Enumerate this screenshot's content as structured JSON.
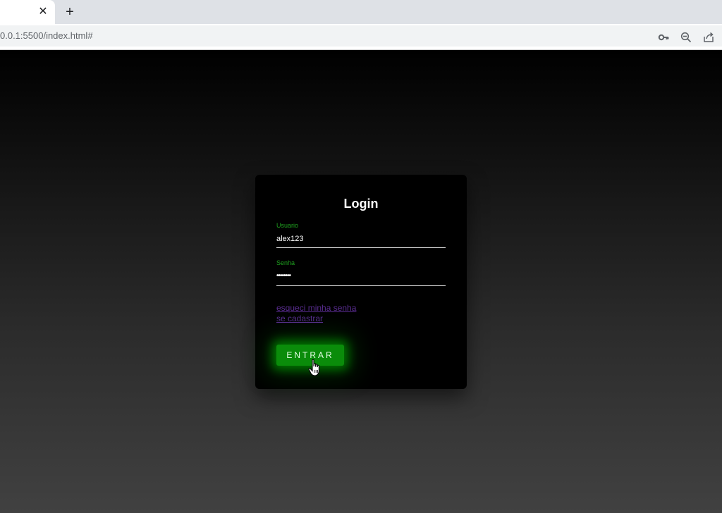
{
  "browser": {
    "tab_close_glyph": "✕",
    "new_tab_glyph": "+",
    "url_host": "0.0.1",
    "url_rest": ":5500/index.html#",
    "icons": [
      "key-icon",
      "zoom-out-icon",
      "share-icon"
    ]
  },
  "login": {
    "title": "Login",
    "username_label": "Usuario",
    "username_value": "alex123",
    "password_label": "Senha",
    "password_value": "••••••••",
    "forgot_link": "esqueci minha senha",
    "register_link": "se cadastrar",
    "submit_label": "ENTRAR"
  },
  "colors": {
    "accent_green": "#0a8c0a",
    "label_green": "#1fa01f",
    "link_purple": "#5a2d91",
    "card_bg": "#000000"
  }
}
